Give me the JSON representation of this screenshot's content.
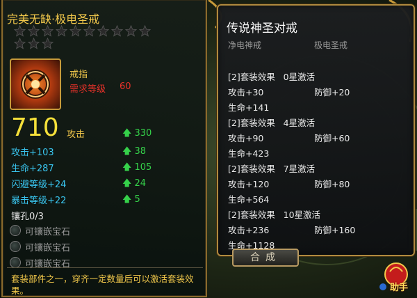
{
  "item": {
    "name": "完美无缺·极电圣戒",
    "stars_total": 10,
    "stars_filled": 0,
    "type": "戒指",
    "level_req_label": "需求等级",
    "level_req_value": "60",
    "power": "710",
    "power_label": "攻击",
    "power_gain": "330",
    "stats": [
      {
        "label": "攻击+103",
        "gain": "38"
      },
      {
        "label": "生命+287",
        "gain": "105"
      },
      {
        "label": "闪避等级+24",
        "gain": "24"
      },
      {
        "label": "暴击等级+22",
        "gain": "5"
      }
    ],
    "sockets_label": "镶孔0/3",
    "sockets": [
      {
        "label": "可镶嵌宝石"
      },
      {
        "label": "可镶嵌宝石"
      },
      {
        "label": "可镶嵌宝石"
      }
    ],
    "description": "套装部件之一，穿齐一定数量后可以激活套装效果。"
  },
  "set": {
    "title": "传说神圣对戒",
    "members": [
      "净电神戒",
      "极电圣戒"
    ],
    "effects": [
      {
        "header": "[2]套装效果   0星激活",
        "atk": "攻击+30",
        "def": "防御+20",
        "hp": "生命+141"
      },
      {
        "header": "[2]套装效果   4星激活",
        "atk": "攻击+90",
        "def": "防御+60",
        "hp": "生命+423"
      },
      {
        "header": "[2]套装效果   7星激活",
        "atk": "攻击+120",
        "def": "防御+80",
        "hp": "生命+564"
      },
      {
        "header": "[2]套装效果   10星激活",
        "atk": "攻击+236",
        "def": "防御+160",
        "hp": "生命+1128"
      }
    ]
  },
  "buttons": {
    "merge": "合成",
    "helper": "助手"
  },
  "colors": {
    "gold": "#f2c84b",
    "cyan": "#39c6f0",
    "green": "#35d14a",
    "red": "#e8322a"
  }
}
